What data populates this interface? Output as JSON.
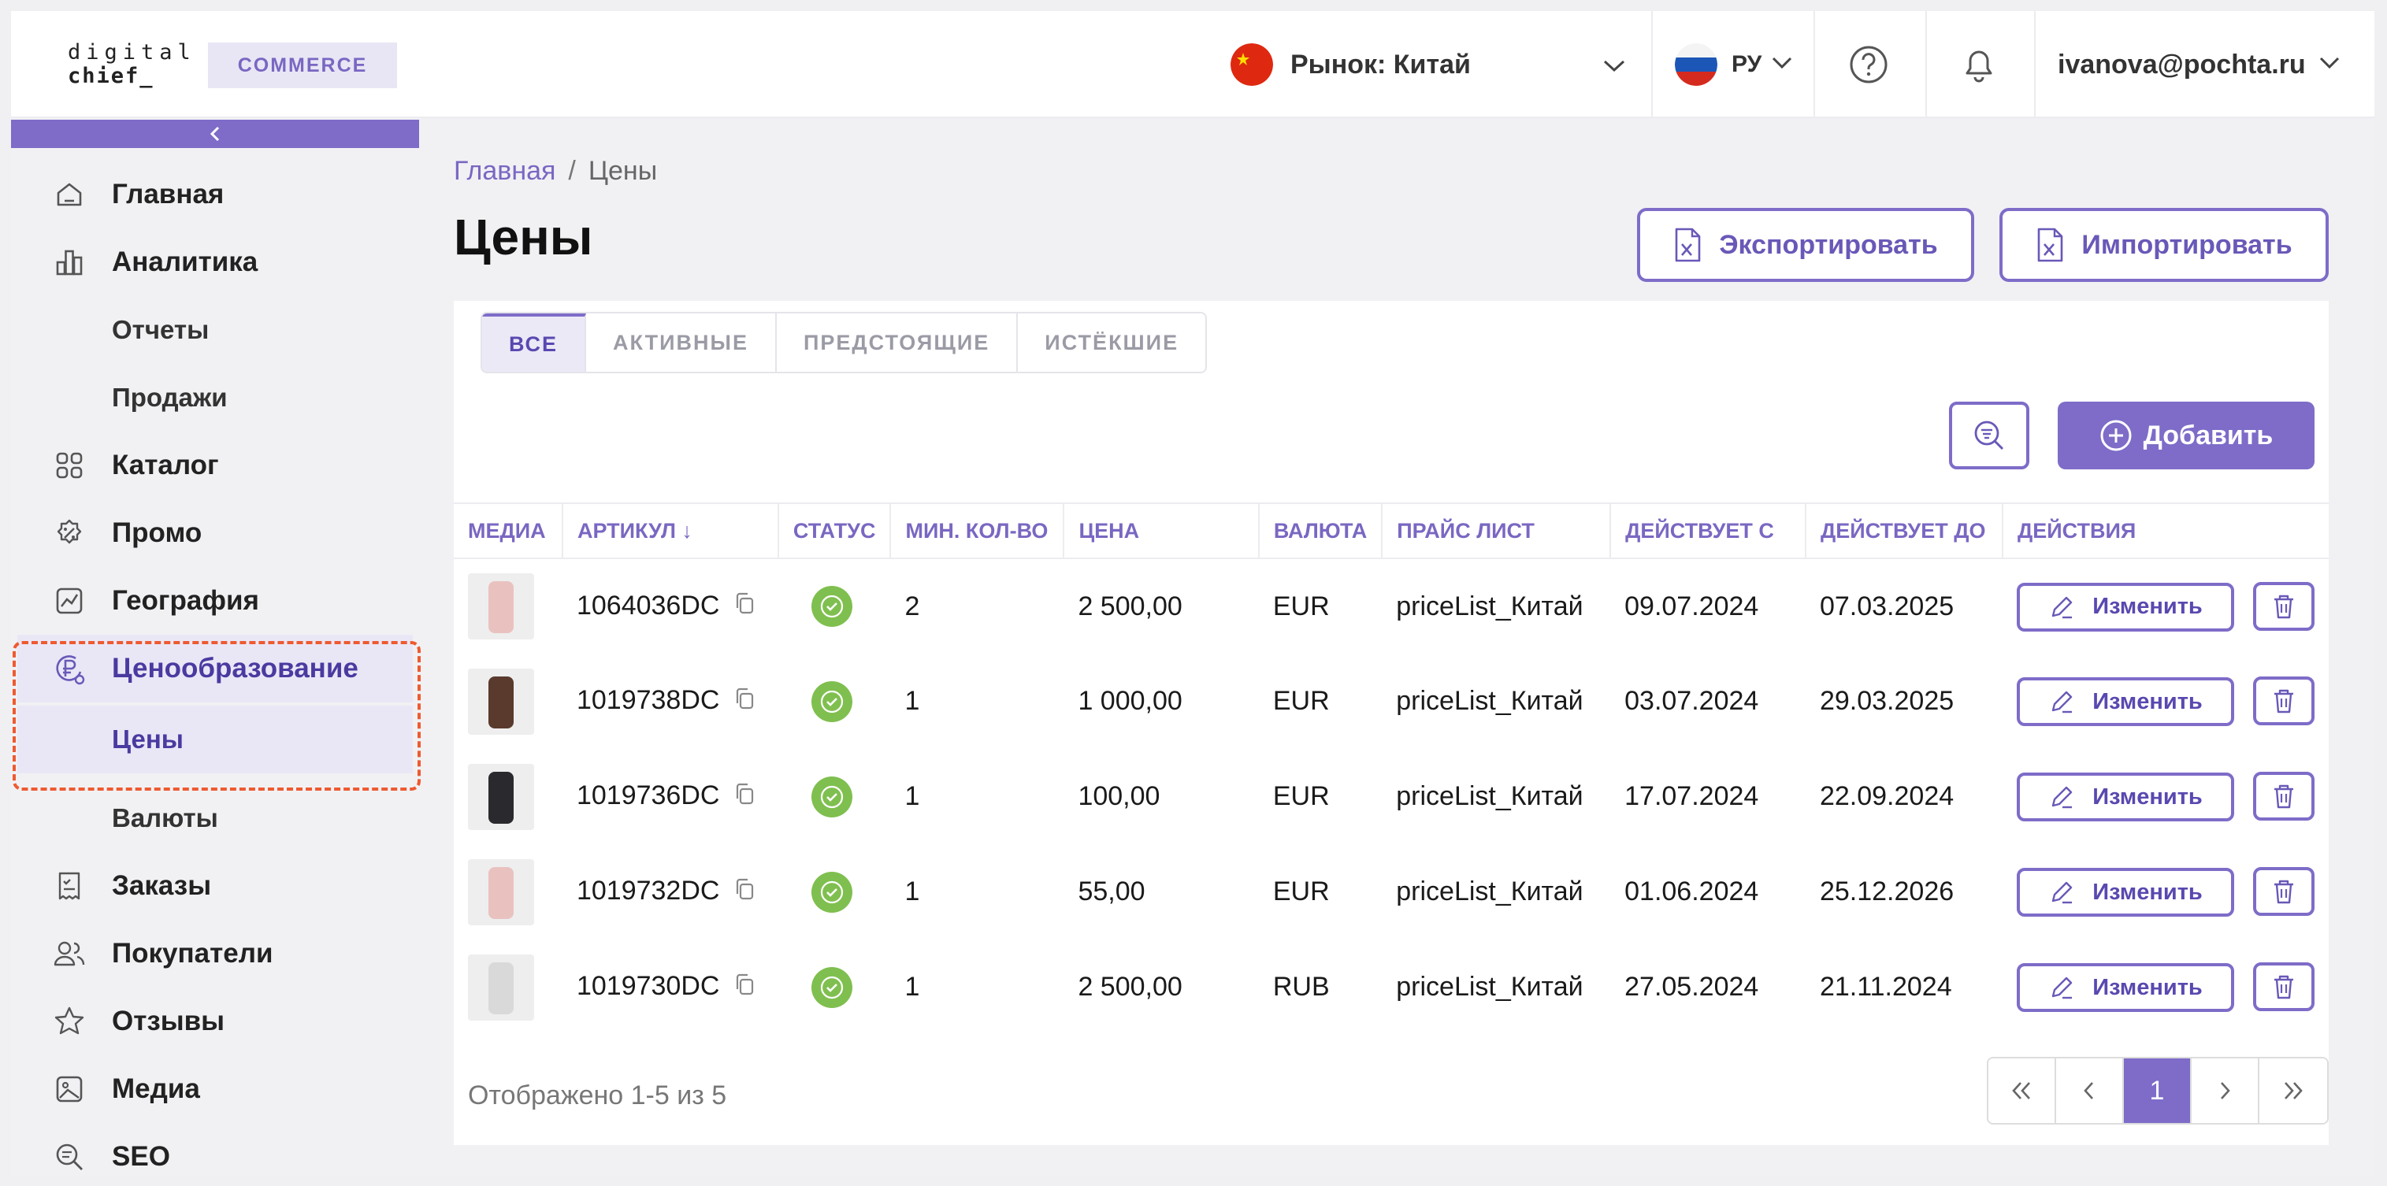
{
  "header": {
    "logo_line1": "digital",
    "logo_line2": "chief_",
    "logo_badge": "COMMERCE",
    "market_label": "Рынок: Китай",
    "lang_label": "РУ",
    "user_email": "ivanova@pochta.ru"
  },
  "sidebar": {
    "items": [
      {
        "label": "Главная",
        "icon": "home-icon"
      },
      {
        "label": "Аналитика",
        "icon": "analytics-icon"
      },
      {
        "label": "Отчеты"
      },
      {
        "label": "Продажи"
      },
      {
        "label": "Каталог",
        "icon": "catalog-icon"
      },
      {
        "label": "Промо",
        "icon": "promo-icon"
      },
      {
        "label": "География",
        "icon": "geography-icon"
      },
      {
        "label": "Ценообразование",
        "icon": "ruble-icon"
      },
      {
        "label": "Цены"
      },
      {
        "label": "Валюты"
      },
      {
        "label": "Заказы",
        "icon": "orders-icon"
      },
      {
        "label": "Покупатели",
        "icon": "customers-icon"
      },
      {
        "label": "Отзывы",
        "icon": "star-icon"
      },
      {
        "label": "Медиа",
        "icon": "image-icon"
      },
      {
        "label": "SEO",
        "icon": "seo-icon"
      }
    ]
  },
  "breadcrumb": {
    "home": "Главная",
    "sep": "/",
    "current": "Цены"
  },
  "page": {
    "title": "Цены",
    "export_label": "Экспортировать",
    "import_label": "Импортировать",
    "add_label": "Добавить"
  },
  "tabs": [
    "ВСЕ",
    "АКТИВНЫЕ",
    "ПРЕДСТОЯЩИЕ",
    "ИСТЁКШИЕ"
  ],
  "table": {
    "columns": [
      "МЕДИА",
      "АРТИКУЛ ↓",
      "СТАТУС",
      "МИН. КОЛ-ВО",
      "ЦЕНА",
      "ВАЛЮТА",
      "ПРАЙС ЛИСТ",
      "ДЕЙСТВУЕТ С",
      "ДЕЙСТВУЕТ ДО",
      "ДЕЙСТВИЯ"
    ],
    "edit_label": "Изменить",
    "rows": [
      {
        "sku": "1064036DC",
        "min_qty": "2",
        "price": "2 500,00",
        "currency": "EUR",
        "price_list": "priceList_Китай",
        "from": "09.07.2024",
        "to": "07.03.2025",
        "thumb_color": "#e9c2c0"
      },
      {
        "sku": "1019738DC",
        "min_qty": "1",
        "price": "1 000,00",
        "currency": "EUR",
        "price_list": "priceList_Китай",
        "from": "03.07.2024",
        "to": "29.03.2025",
        "thumb_color": "#5a3a2c"
      },
      {
        "sku": "1019736DC",
        "min_qty": "1",
        "price": "100,00",
        "currency": "EUR",
        "price_list": "priceList_Китай",
        "from": "17.07.2024",
        "to": "22.09.2024",
        "thumb_color": "#2a2a2e"
      },
      {
        "sku": "1019732DC",
        "min_qty": "1",
        "price": "55,00",
        "currency": "EUR",
        "price_list": "priceList_Китай",
        "from": "01.06.2024",
        "to": "25.12.2026",
        "thumb_color": "#e9c2c0"
      },
      {
        "sku": "1019730DC",
        "min_qty": "1",
        "price": "2 500,00",
        "currency": "RUB",
        "price_list": "priceList_Китай",
        "from": "27.05.2024",
        "to": "21.11.2024",
        "thumb_color": "#d9d9d9"
      }
    ]
  },
  "footer": {
    "shown_text": "Отображено 1-5 из 5",
    "current_page": "1"
  },
  "colors": {
    "accent": "#7e6cc8",
    "status_ok": "#7fbf4f",
    "highlight": "#ee5a30"
  }
}
